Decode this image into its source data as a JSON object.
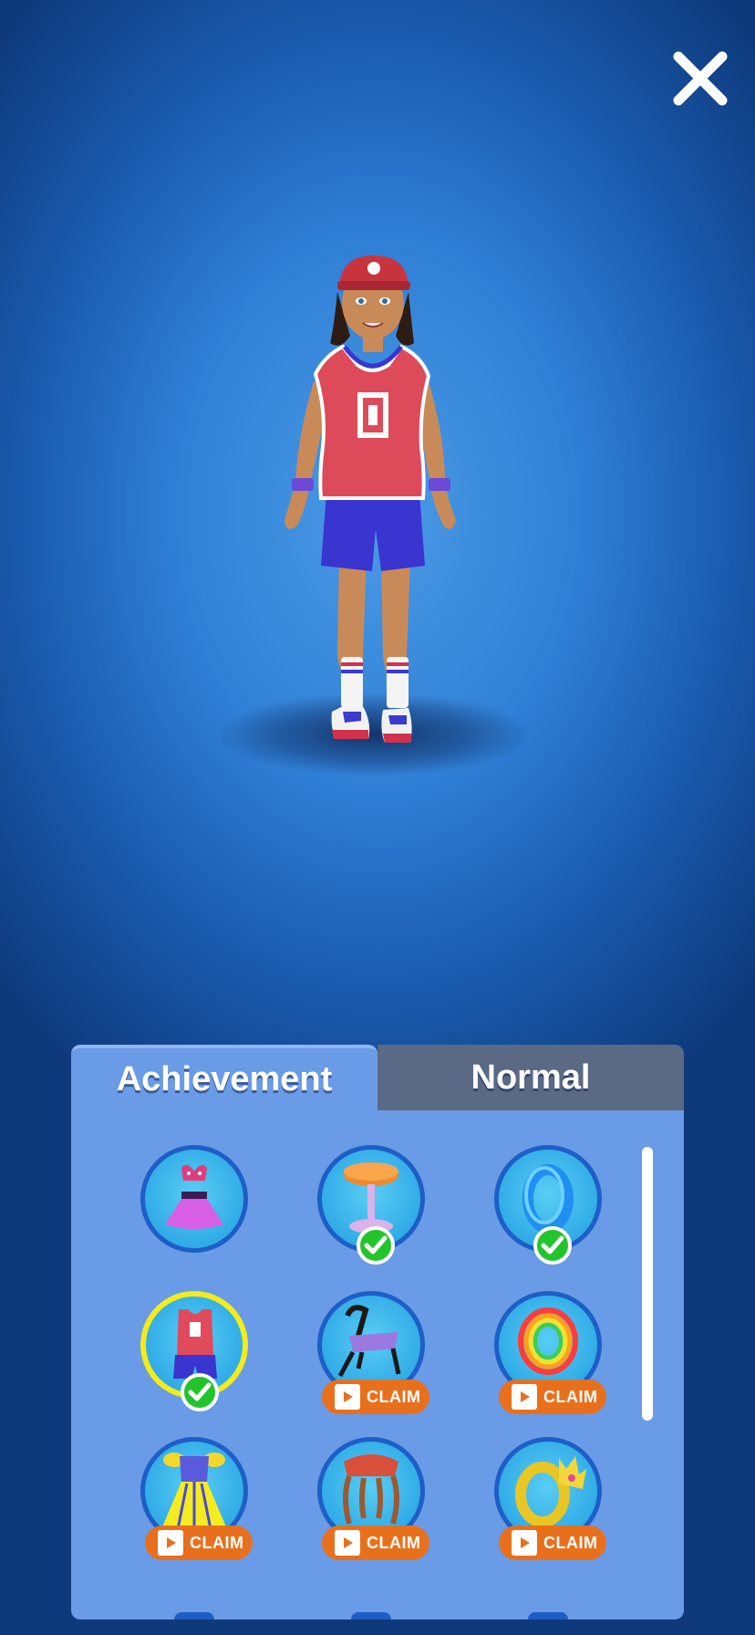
{
  "header": {
    "close_icon": "close-icon"
  },
  "tabs": [
    {
      "label": "Achievement",
      "active": true
    },
    {
      "label": "Normal",
      "active": false
    }
  ],
  "items": [
    {
      "name": "bikini-skirt-outfit",
      "owned": false,
      "claim": false
    },
    {
      "name": "orange-stool",
      "owned": true,
      "claim": false
    },
    {
      "name": "blue-ring",
      "owned": true,
      "claim": false
    },
    {
      "name": "basketball-outfit",
      "owned": true,
      "selected": true,
      "claim": false
    },
    {
      "name": "purple-chair",
      "owned": false,
      "claim": true,
      "claim_label": "CLAIM"
    },
    {
      "name": "rainbow-ring",
      "owned": false,
      "claim": true,
      "claim_label": "CLAIM"
    },
    {
      "name": "yellow-princess-dress",
      "owned": false,
      "claim": true,
      "claim_label": "CLAIM"
    },
    {
      "name": "red-stool",
      "owned": false,
      "claim": true,
      "claim_label": "CLAIM"
    },
    {
      "name": "crown-ring",
      "owned": false,
      "claim": true,
      "claim_label": "CLAIM"
    }
  ],
  "colors": {
    "panel": "#6a9be6",
    "tab_inactive": "#5a6984",
    "slot_border": "#1d5ec7",
    "selected_border": "#f3ec1a",
    "check": "#22c42c",
    "claim": "#e8701d"
  }
}
